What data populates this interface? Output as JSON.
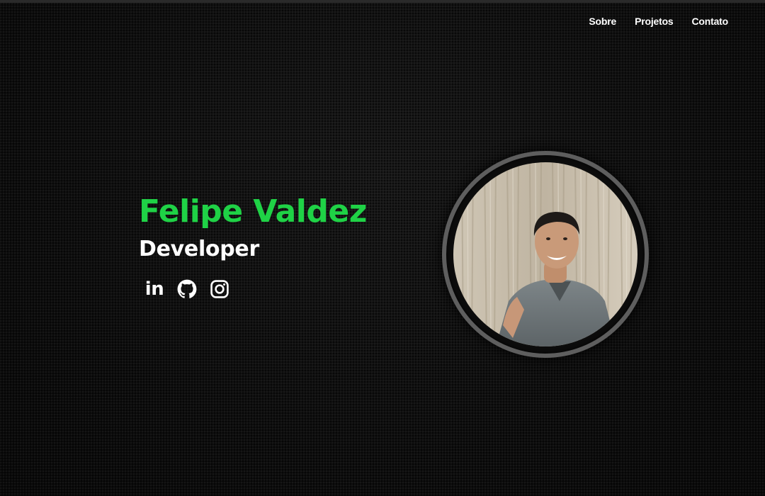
{
  "nav": {
    "items": [
      {
        "label": "Sobre"
      },
      {
        "label": "Projetos"
      },
      {
        "label": "Contato"
      }
    ]
  },
  "hero": {
    "name": "Felipe Valdez",
    "role": "Developer",
    "accent_color": "#1fd246",
    "socials": [
      {
        "icon": "linkedin-icon",
        "label": "in"
      },
      {
        "icon": "github-icon"
      },
      {
        "icon": "instagram-icon"
      }
    ]
  },
  "profile_photo": {
    "icon": "profile-photo"
  }
}
